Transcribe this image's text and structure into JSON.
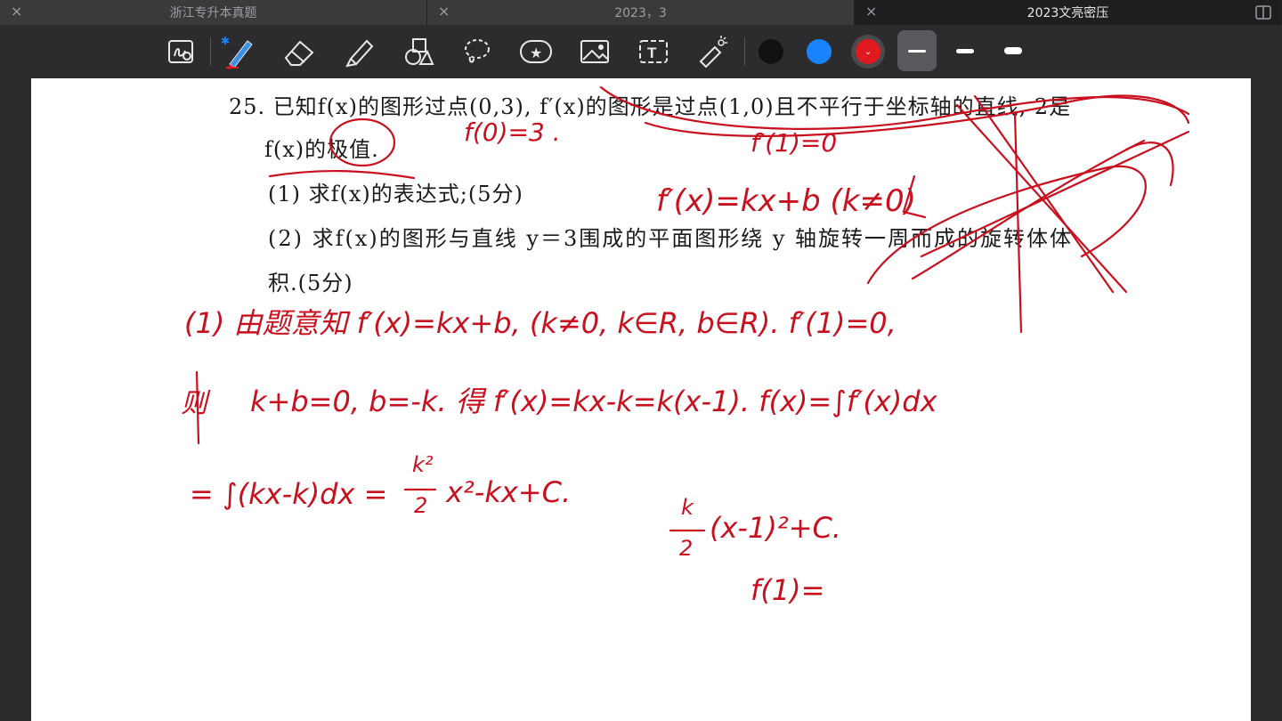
{
  "tabs": [
    {
      "label": "浙江专升本真题",
      "close": "×",
      "active": false
    },
    {
      "label": "2023，3",
      "close": "×",
      "active": false
    },
    {
      "label": "2023文亮密压",
      "close": "×",
      "active": true
    }
  ],
  "toolbar": {
    "tools": [
      "lasso-zoom-icon",
      "pen-icon",
      "eraser-icon",
      "highlighter-icon",
      "shapes-icon",
      "lasso-icon",
      "sticker-icon",
      "image-icon",
      "text-icon",
      "laser-pointer-icon"
    ],
    "colors": [
      "#111111",
      "#1a84ff",
      "#e0191e"
    ],
    "selected_color": "#e0191e",
    "weights": [
      "thin",
      "medium",
      "thick"
    ],
    "selected_weight": "thin"
  },
  "question": {
    "line1": "25. 已知f(x)的图形过点(0,3), f′(x)的图形是过点(1,0)且不平行于坐标轴的直线, 2是",
    "line2": "f(x)的极值.",
    "part1": "(1) 求f(x)的表达式;(5分)",
    "part2": "(2) 求f(x)的图形与直线 y＝3围成的平面图形绕 y 轴旋转一周而成的旋转体体",
    "part2_cont": "积.(5分)"
  },
  "handwriting": {
    "note_f0": "f(0)=3 .",
    "note_fp1": "f′(1)=0",
    "note_fp_line": "f′(x)=kx+b  (k≠0)",
    "step1": "(1) 由题意知 f′(x)=kx+b, (k≠0, k∈R, b∈R). f′(1)=0,",
    "step2_label": "则",
    "step2": "k+b=0, b=-k. 得 f′(x)=kx-k=k(x-1). f(x)=∫f′(x)dx",
    "step3": "= ∫(kx-k)dx = ",
    "step3_frac_num": "k²",
    "step3_frac_den": "2",
    "step3_rest": "x²-kx+C.",
    "side_frac_num": "k",
    "side_frac_den": "2",
    "side_rest": "(x-1)²+C.",
    "side_f1": "f(1)="
  }
}
